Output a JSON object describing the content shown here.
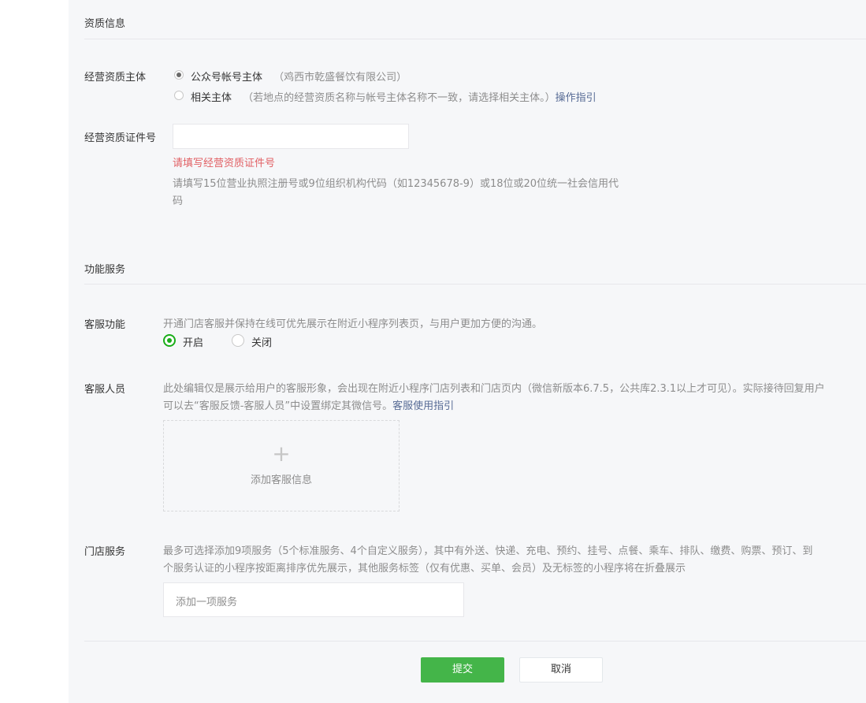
{
  "qualification": {
    "section_title": "资质信息",
    "subject_label": "经营资质主体",
    "options": [
      {
        "label": "公众号帐号主体",
        "note": "（鸡西市乾盛餐饮有限公司）",
        "checked": true
      },
      {
        "label": "相关主体",
        "note": "（若地点的经营资质名称与帐号主体名称不一致，请选择相关主体。）",
        "link": "操作指引",
        "checked": false
      }
    ],
    "cert_label": "经营资质证件号",
    "cert_value": "",
    "cert_error": "请填写经营资质证件号",
    "cert_hint_line1": "请填写15位营业执照注册号或9位组织机构代码（如12345678-9）或18位或20位统一社会信用代",
    "cert_hint_line2": "码"
  },
  "services": {
    "section_title": "功能服务",
    "cs_label": "客服功能",
    "cs_desc": "开通门店客服并保持在线可优先展示在附近小程序列表页，与用户更加方便的沟通。",
    "cs_on": "开启",
    "cs_off": "关闭",
    "cs_enabled": true,
    "staff_label": "客服人员",
    "staff_desc_line1": "此处编辑仅是展示给用户的客服形象，会出现在附近小程序门店列表和门店页内（微信新版本6.7.5，公共库2.3.1以上才可见）。实际接待回复用户",
    "staff_desc_line2": "可以去“客服反馈-客服人员”中设置绑定其微信号。",
    "staff_link": "客服使用指引",
    "add_plus": "+",
    "add_staff": "添加客服信息",
    "store_label": "门店服务",
    "store_desc_line1": "最多可选择添加9项服务（5个标准服务、4个自定义服务），其中有外送、快递、充电、预约、挂号、点餐、乘车、排队、缴费、购票、预订、到",
    "store_desc_line2": "个服务认证的小程序按距离排序优先展示，其他服务标签（仅有优惠、买单、会员）及无标签的小程序将在折叠展示",
    "store_placeholder": "添加一项服务"
  },
  "footer": {
    "submit": "提交",
    "cancel": "取消"
  },
  "colors": {
    "accent_green": "#1aad19",
    "button_green": "#44b549",
    "error_red": "#e15f63",
    "link_blue": "#576b95"
  }
}
